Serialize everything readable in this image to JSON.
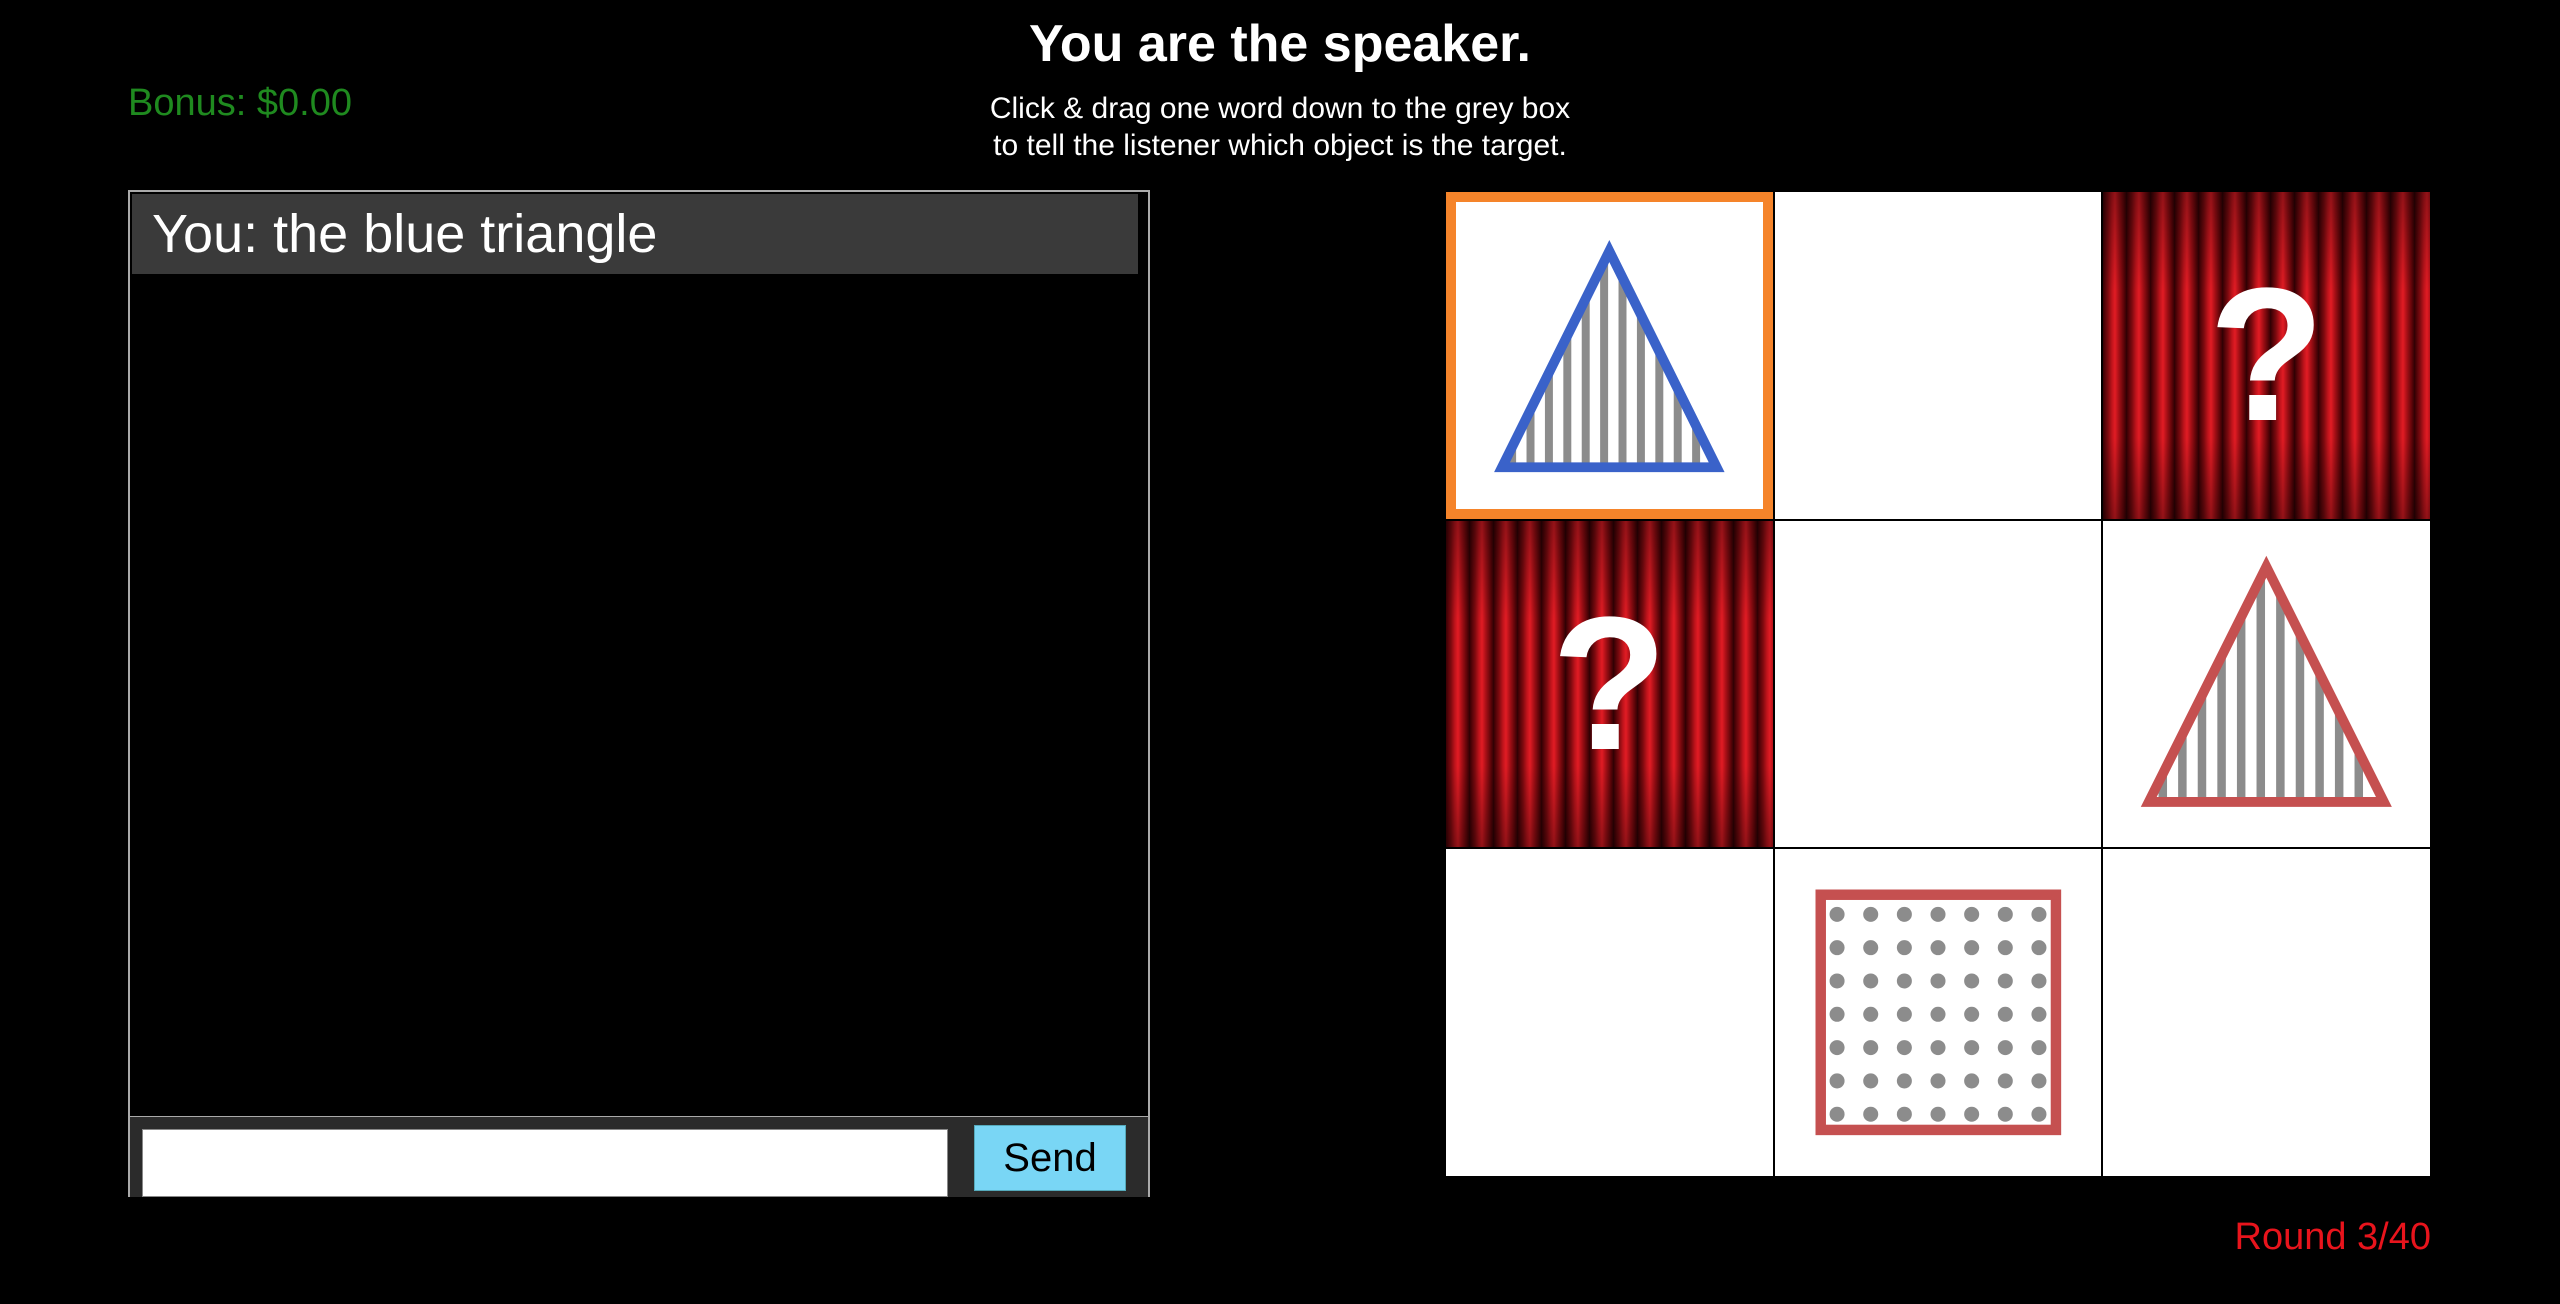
{
  "header": {
    "title": "You are the speaker.",
    "instructions": [
      "Click & drag one word down to the grey box",
      "to tell the listener which object is the target."
    ]
  },
  "bonus": "Bonus: $0.00",
  "round": "Round 3/40",
  "chat": {
    "messages": [
      "You: the blue triangle"
    ],
    "input_value": "",
    "send_label": "Send"
  },
  "grid": {
    "cells": [
      {
        "content": "triangle",
        "color": "#3a62c9",
        "pattern": "vertical-stripes",
        "target": true
      },
      {
        "content": "empty"
      },
      {
        "content": "hidden",
        "symbol": "?"
      },
      {
        "content": "hidden",
        "symbol": "?"
      },
      {
        "content": "empty"
      },
      {
        "content": "triangle",
        "color": "#c55050",
        "pattern": "vertical-stripes",
        "target": false
      },
      {
        "content": "empty"
      },
      {
        "content": "square",
        "color": "#c55050",
        "pattern": "dots",
        "target": false
      },
      {
        "content": "empty"
      }
    ]
  },
  "colors": {
    "target_border": "#f5842a",
    "bonus": "#1f8a1f",
    "round": "#e8141c",
    "send_button": "#79d6f5",
    "pattern_gray": "#8c8c8c"
  }
}
